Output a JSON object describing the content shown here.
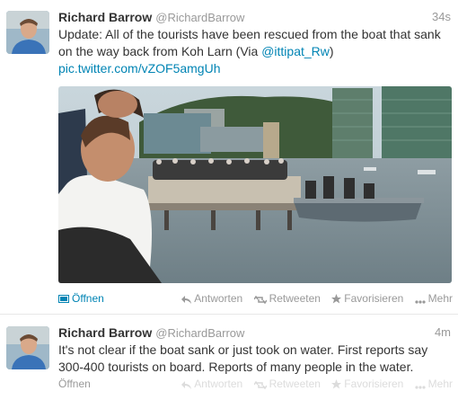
{
  "tweets": [
    {
      "fullname": "Richard Barrow",
      "username": "@RichardBarrow",
      "time": "34s",
      "text_before": "Update: All of the tourists have been rescued from the boat that sank on the way back from Koh Larn (Via ",
      "mention": "@ittipat_Rw",
      "text_after": ")",
      "link": "pic.twitter.com/vZOF5amgUh",
      "open_label": "Öffnen",
      "actions": {
        "reply": "Antworten",
        "retweet": "Retweeten",
        "favorite": "Favorisieren",
        "more": "Mehr"
      }
    },
    {
      "fullname": "Richard Barrow",
      "username": "@RichardBarrow",
      "time": "4m",
      "text": "It's not clear if the boat sank or just took on water. First reports say 300-400 tourists on board. Reports of many people in the water.",
      "open_label": "Öffnen",
      "actions": {
        "reply": "Antworten",
        "retweet": "Retweeten",
        "favorite": "Favorisieren",
        "more": "Mehr"
      }
    }
  ],
  "colors": {
    "link": "#0084b4",
    "muted": "#999999",
    "text": "#333333"
  }
}
